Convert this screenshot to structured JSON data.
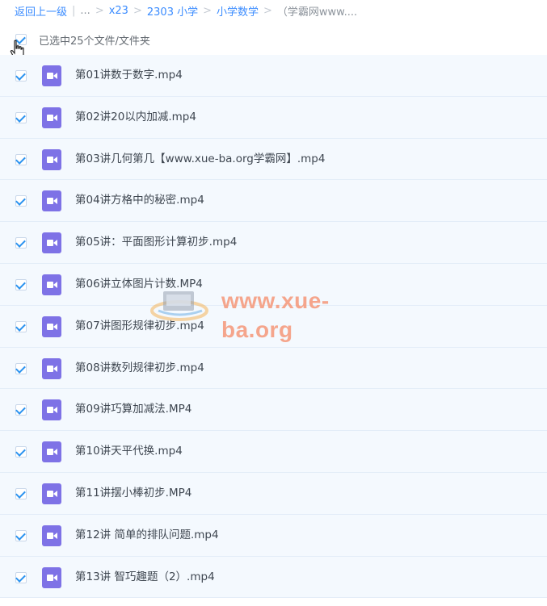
{
  "breadcrumb": {
    "back": "返回上一级",
    "sep": "|",
    "ellipsis": "...",
    "gt": ">",
    "items": [
      "x23",
      "2303 小学",
      "小学数学"
    ],
    "current": "（学霸网www...."
  },
  "selection": {
    "label": "已选中25个文件/文件夹"
  },
  "files": [
    {
      "name": "第01讲数于数字.mp4"
    },
    {
      "name": "第02讲20以内加减.mp4"
    },
    {
      "name": "第03讲几何第几【www.xue-ba.org学霸网】.mp4"
    },
    {
      "name": "第04讲方格中的秘密.mp4"
    },
    {
      "name": "第05讲：平面图形计算初步.mp4"
    },
    {
      "name": "第06讲立体图片计数.MP4"
    },
    {
      "name": "第07讲图形规律初步.mp4"
    },
    {
      "name": "第08讲数列规律初步.mp4"
    },
    {
      "name": "第09讲巧算加减法.MP4"
    },
    {
      "name": "第10讲天平代换.mp4"
    },
    {
      "name": "第11讲摆小棒初步.MP4"
    },
    {
      "name": "第12讲 简单的排队问题.mp4"
    },
    {
      "name": "第13讲 智巧趣题（2）.mp4"
    }
  ],
  "watermark": {
    "text": "www.xue-ba.org"
  },
  "colors": {
    "link": "#3b8cff",
    "row_bg": "#f4f9fe",
    "video_icon": "#7e72e6",
    "check": "#2b93f0",
    "watermark": "#f4977a"
  },
  "icons": {
    "file": "video-file-icon",
    "cursor": "hand-pointer-cursor"
  }
}
